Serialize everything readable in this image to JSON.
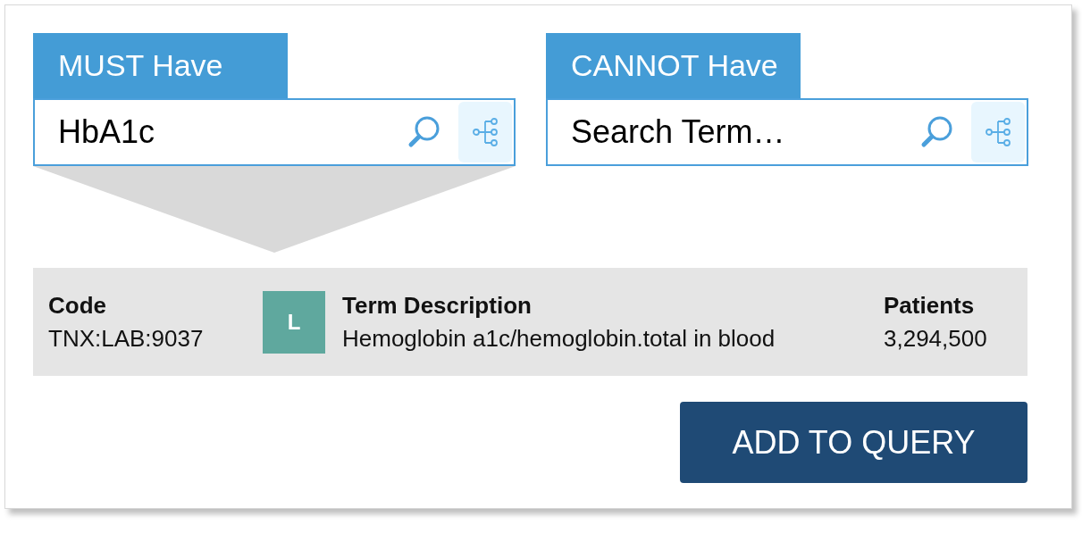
{
  "panels": [
    {
      "title": "MUST Have",
      "value": "HbA1c"
    },
    {
      "title": "CANNOT Have",
      "placeholder": "Search Term…"
    }
  ],
  "result": {
    "code_label": "Code",
    "code": "TNX:LAB:9037",
    "badge": "L",
    "description_label": "Term Description",
    "description": "Hemoglobin a1c/hemoglobin.total in blood",
    "patients_label": "Patients",
    "patients": "3,294,500"
  },
  "button": "ADD TO QUERY"
}
